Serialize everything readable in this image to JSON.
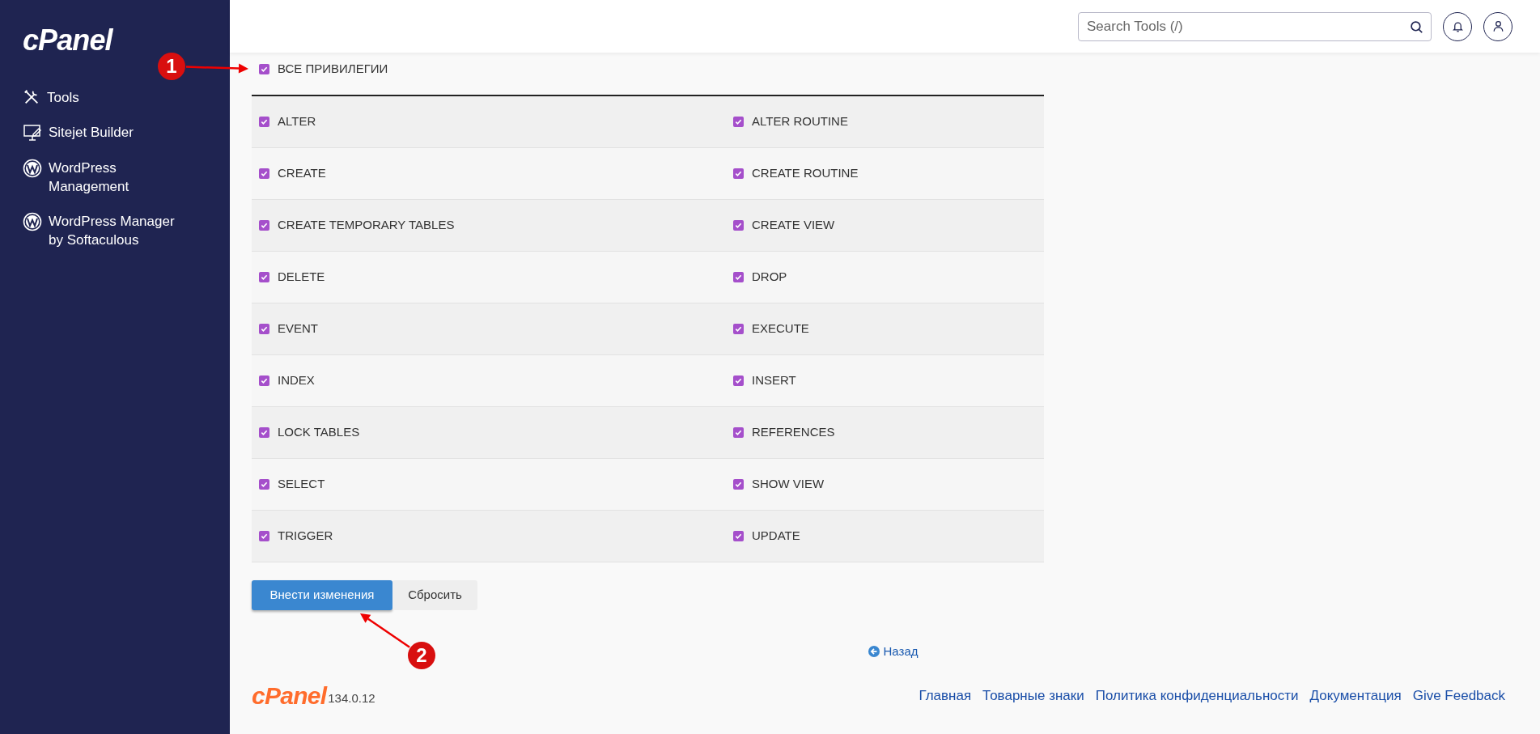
{
  "sidebar": {
    "logo": "cPanel",
    "items": [
      {
        "kind": "tools",
        "label": "Tools"
      },
      {
        "kind": "builder",
        "label": "Sitejet Builder"
      },
      {
        "kind": "wordpress",
        "label": "WordPress Management"
      },
      {
        "kind": "wordpress",
        "label": "WordPress Manager by Softaculous"
      }
    ]
  },
  "header": {
    "search": {
      "placeholder": "Search Tools (/)"
    }
  },
  "all_privileges": {
    "label": "ВСЕ ПРИВИЛЕГИИ",
    "checked": true
  },
  "privileges": [
    {
      "label": "ALTER",
      "checked": true
    },
    {
      "label": "ALTER ROUTINE",
      "checked": true
    },
    {
      "label": "CREATE",
      "checked": true
    },
    {
      "label": "CREATE ROUTINE",
      "checked": true
    },
    {
      "label": "CREATE TEMPORARY TABLES",
      "checked": true
    },
    {
      "label": "CREATE VIEW",
      "checked": true
    },
    {
      "label": "DELETE",
      "checked": true
    },
    {
      "label": "DROP",
      "checked": true
    },
    {
      "label": "EVENT",
      "checked": true
    },
    {
      "label": "EXECUTE",
      "checked": true
    },
    {
      "label": "INDEX",
      "checked": true
    },
    {
      "label": "INSERT",
      "checked": true
    },
    {
      "label": "LOCK TABLES",
      "checked": true
    },
    {
      "label": "REFERENCES",
      "checked": true
    },
    {
      "label": "SELECT",
      "checked": true
    },
    {
      "label": "SHOW VIEW",
      "checked": true
    },
    {
      "label": "TRIGGER",
      "checked": true
    },
    {
      "label": "UPDATE",
      "checked": true
    }
  ],
  "buttons": [
    {
      "label": "Внести изменения",
      "kind": "primary"
    },
    {
      "label": "Сбросить",
      "kind": "secondary"
    }
  ],
  "back_link": "Назад",
  "footer": {
    "logo": "cPanel",
    "version": "134.0.12",
    "links": [
      "Главная",
      "Товарные знаки",
      "Политика конфиденциальности",
      "Документация",
      "Give Feedback"
    ]
  },
  "annotations": [
    {
      "number": "1"
    },
    {
      "number": "2"
    }
  ]
}
